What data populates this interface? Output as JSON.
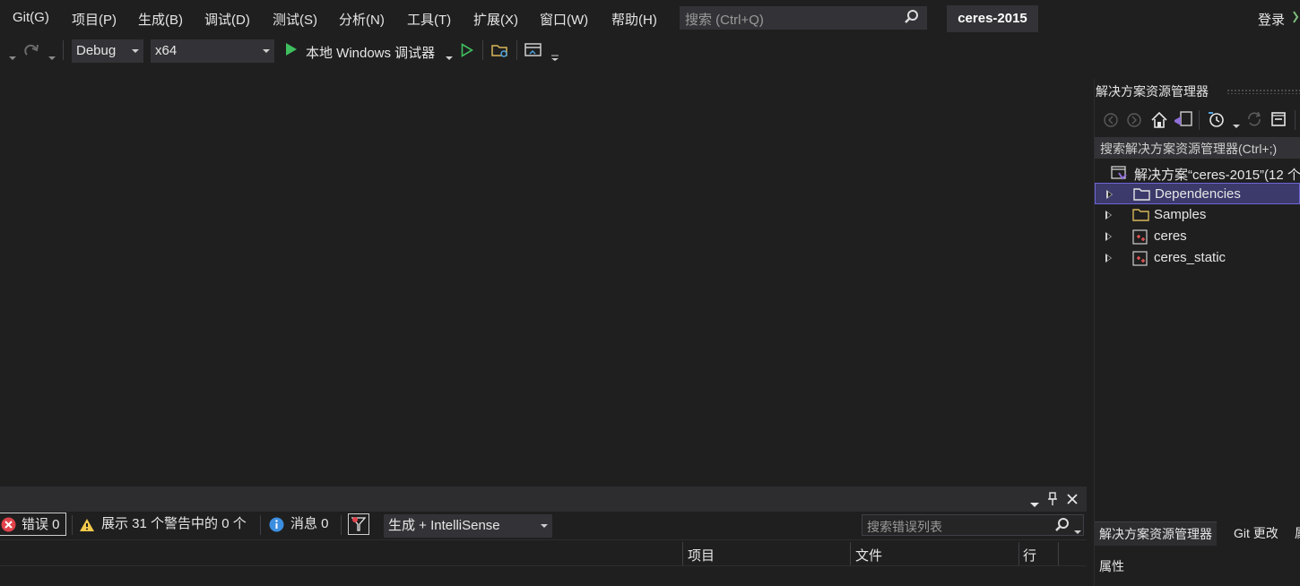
{
  "menu": [
    "Git(G)",
    "项目(P)",
    "生成(B)",
    "调试(D)",
    "测试(S)",
    "分析(N)",
    "工具(T)",
    "扩展(X)",
    "窗口(W)",
    "帮助(H)"
  ],
  "search": {
    "placeholder": "搜索 (Ctrl+Q)"
  },
  "solution_title": "ceres-2015",
  "signin": "登录",
  "toolbar": {
    "config": "Debug",
    "platform": "x64",
    "run_label": "本地 Windows 调试器"
  },
  "solution_explorer": {
    "title": "解决方案资源管理器",
    "search_placeholder": "搜索解决方案资源管理器(Ctrl+;)",
    "solution_label": "解决方案“ceres-2015”(12 个",
    "items": [
      {
        "label": "Dependencies",
        "icon": "folder-icon",
        "selected": true
      },
      {
        "label": "Samples",
        "icon": "folder-icon",
        "selected": false
      },
      {
        "label": "ceres",
        "icon": "cpp-project-icon",
        "selected": false
      },
      {
        "label": "ceres_static",
        "icon": "cpp-project-icon",
        "selected": false
      }
    ],
    "tabs": [
      "解决方案资源管理器",
      "Git 更改",
      "属"
    ],
    "properties_title": "属性"
  },
  "error_list": {
    "errors": "错误 0",
    "warnings": "展示 31 个警告中的 0 个",
    "messages": "消息 0",
    "scope": "生成 + IntelliSense",
    "search_placeholder": "搜索错误列表",
    "columns": [
      "项目",
      "文件",
      "行"
    ]
  }
}
